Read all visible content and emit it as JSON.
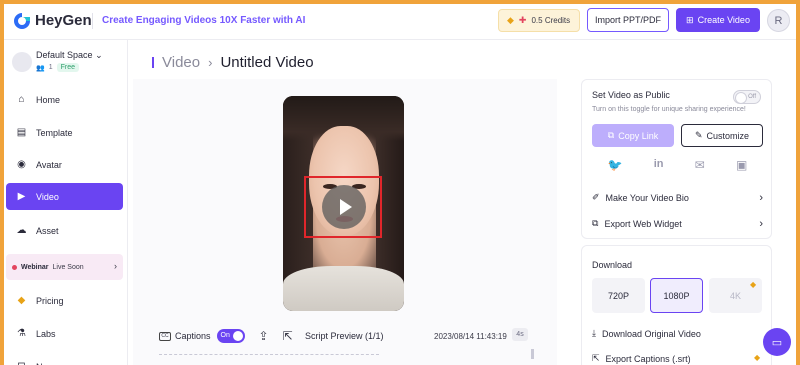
{
  "header": {
    "logo_text": "HeyGen",
    "tagline": "Create Engaging Videos 10X Faster with AI",
    "credits": "0.5 Credits",
    "import_label": "Import PPT/PDF",
    "create_label": "Create Video",
    "avatar_initial": "R"
  },
  "sidebar": {
    "space_name": "Default Space",
    "member_count": "1",
    "plan_badge": "Free",
    "items": [
      {
        "label": "Home",
        "icon": "home-icon"
      },
      {
        "label": "Template",
        "icon": "template-icon"
      },
      {
        "label": "Avatar",
        "icon": "avatar-icon"
      },
      {
        "label": "Video",
        "icon": "video-icon"
      },
      {
        "label": "Asset",
        "icon": "asset-icon"
      },
      {
        "label": "Pricing",
        "icon": "pricing-icon"
      },
      {
        "label": "Labs",
        "icon": "labs-icon"
      },
      {
        "label": "N",
        "icon": "news-icon"
      }
    ],
    "active_item": "Video",
    "webinar_bold": "Webinar",
    "webinar_text": "Live Soon"
  },
  "breadcrumb": {
    "section": "Video",
    "title": "Untitled Video"
  },
  "player": {
    "captions_label": "Captions",
    "captions_toggle": "On",
    "script_preview": "Script Preview (1/1)",
    "date": "2023/08/14 11:43:19",
    "duration": "4s"
  },
  "share": {
    "public_title": "Set Video as Public",
    "public_subtitle": "Turn on this toggle for unique sharing experience!",
    "public_toggle": "Off",
    "copy_link": "Copy Link",
    "customize": "Customize",
    "social_icons": [
      "twitter-icon",
      "linkedin-icon",
      "mail-icon",
      "embed-icon"
    ],
    "bio_link": "Make Your Video Bio",
    "widget_link": "Export Web Widget"
  },
  "download": {
    "title": "Download",
    "resolutions": [
      "720P",
      "1080P",
      "4K"
    ],
    "selected": "1080P",
    "original": "Download Original Video",
    "captions": "Export Captions (.srt)"
  },
  "colors": {
    "accent": "#6a44f2",
    "border_highlight": "#f0a33a",
    "annotation": "#e0262b"
  }
}
